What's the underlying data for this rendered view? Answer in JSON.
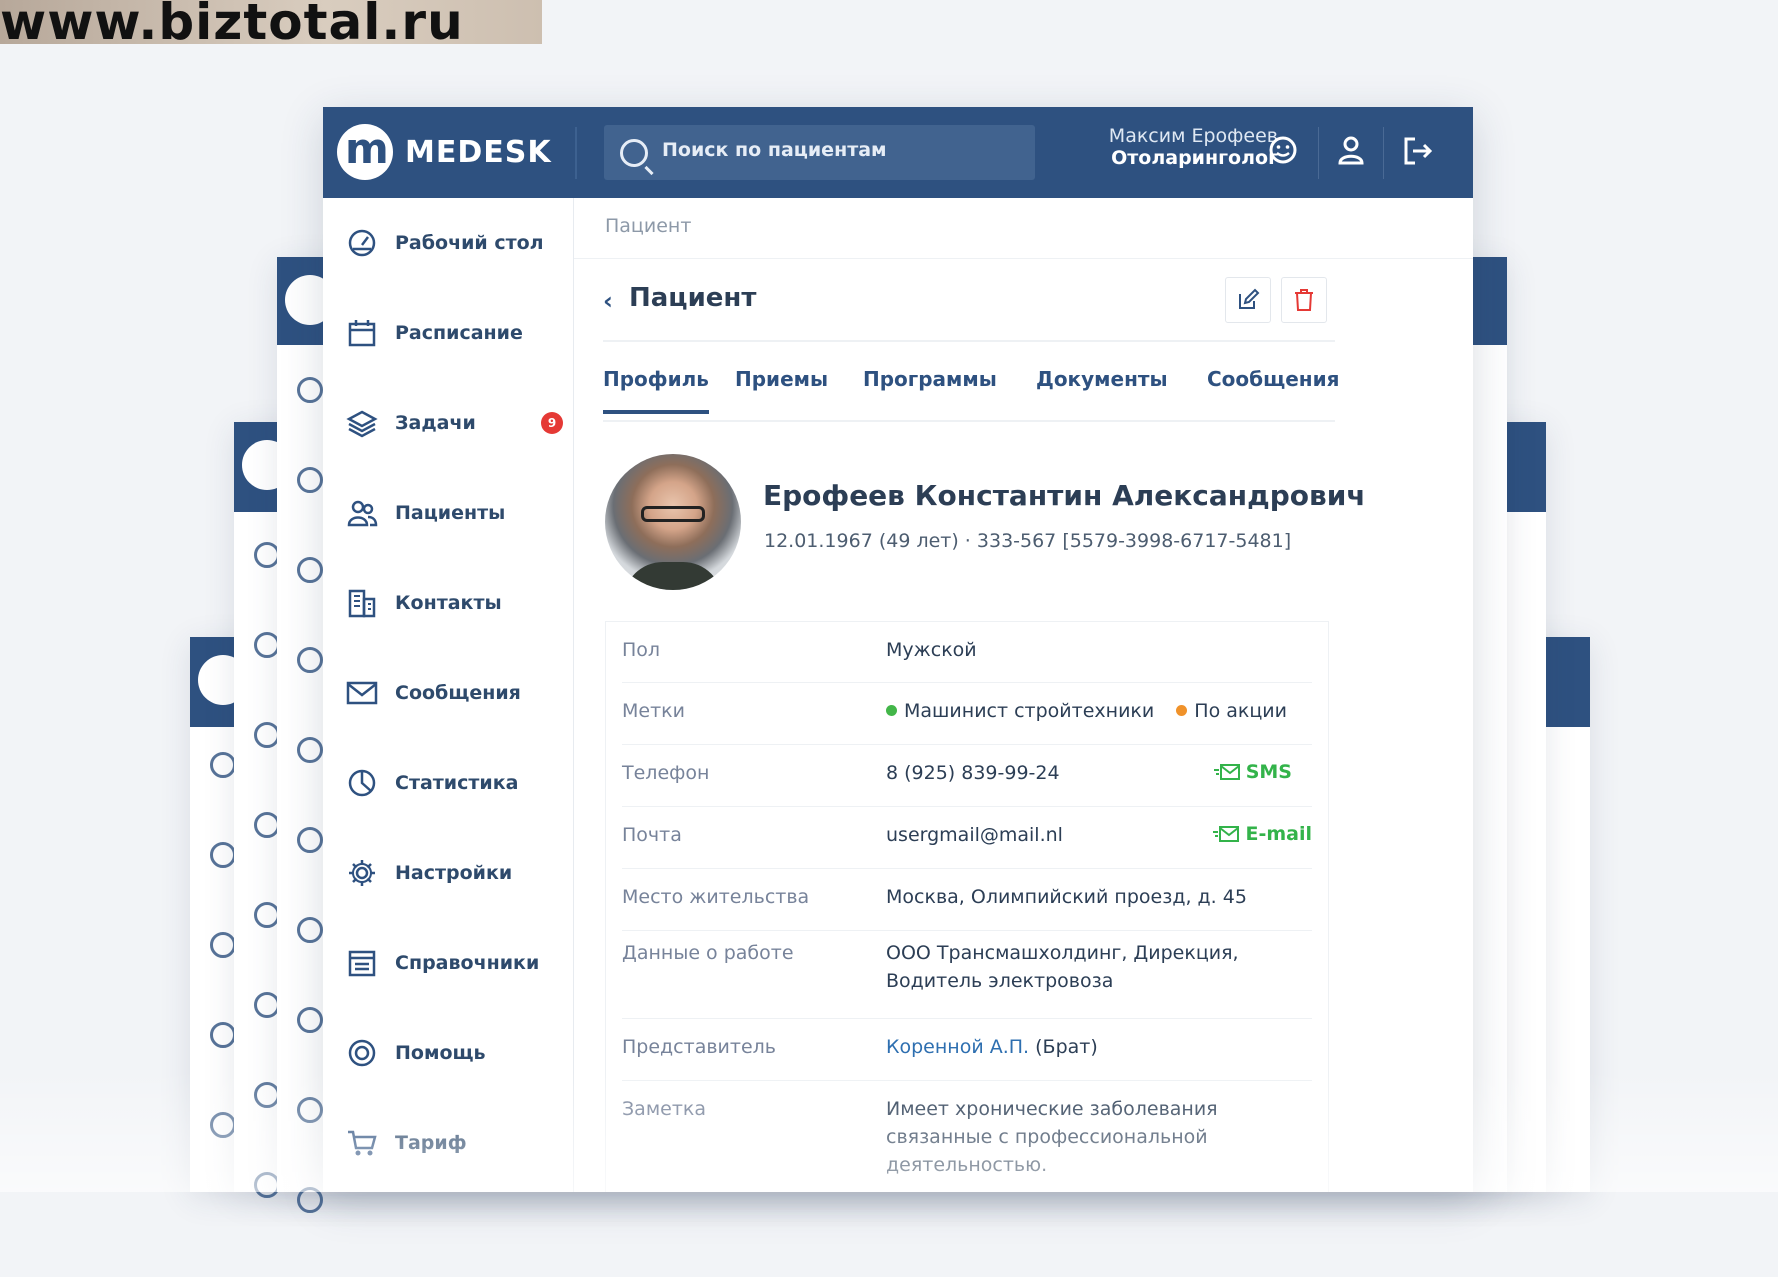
{
  "watermark": "www.biztotal.ru",
  "header": {
    "brand": "MEDESK",
    "search_placeholder": "Поиск по пациентам",
    "user_name": "Максим Ерофеев",
    "user_role": "Отоларинголог"
  },
  "sidebar": {
    "items": [
      {
        "label": "Рабочий стол",
        "icon": "dashboard-icon"
      },
      {
        "label": "Расписание",
        "icon": "calendar-icon"
      },
      {
        "label": "Задачи",
        "icon": "layers-icon",
        "badge": "9"
      },
      {
        "label": "Пациенты",
        "icon": "patients-icon"
      },
      {
        "label": "Контакты",
        "icon": "contacts-icon"
      },
      {
        "label": "Сообщения",
        "icon": "mail-icon"
      },
      {
        "label": "Статистика",
        "icon": "pie-chart-icon"
      },
      {
        "label": "Настройки",
        "icon": "gear-icon"
      },
      {
        "label": "Справочники",
        "icon": "directory-icon"
      },
      {
        "label": "Помощь",
        "icon": "help-icon"
      },
      {
        "label": "Тариф",
        "icon": "cart-icon"
      }
    ]
  },
  "breadcrumb": "Пациент",
  "page_title": "Пациент",
  "tabs": [
    "Профиль",
    "Приемы",
    "Программы",
    "Документы",
    "Сообщения"
  ],
  "active_tab": "Профиль",
  "patient": {
    "name": "Ерофеев Константин Александрович",
    "meta": "12.01.1967 (49 лет)  ·  333-567 [5579-3998-6717-5481]"
  },
  "details": {
    "gender_label": "Пол",
    "gender_value": "Мужской",
    "tags_label": "Метки",
    "tag1": "Машинист стройтехники",
    "tag1_color": "#43b649",
    "tag2": "По акции",
    "tag2_color": "#f0922a",
    "phone_label": "Телефон",
    "phone_value": "8 (925) 839-99-24",
    "sms_label": "SMS",
    "email_label": "Почта",
    "email_value": "usergmail@mail.nl",
    "email_action": "E-mail",
    "address_label": "Место жительства",
    "address_value": "Москва, Олимпийский проезд, д. 45",
    "work_label": "Данные о работе",
    "work_line1": "ООО Трансмашхолдинг, Дирекция,",
    "work_line2": "Водитель электровоза",
    "rep_label": "Представитель",
    "rep_name": "Коренной А.П.",
    "rep_relation": " (Брат)",
    "note_label": "Заметка",
    "note_line1": "Имеет хронические заболевания",
    "note_line2": "связанные с профессиональной",
    "note_line3": "деятельностью."
  },
  "colors": {
    "primary": "#2e5180",
    "accent_green": "#33b34a",
    "danger": "#e53935"
  }
}
